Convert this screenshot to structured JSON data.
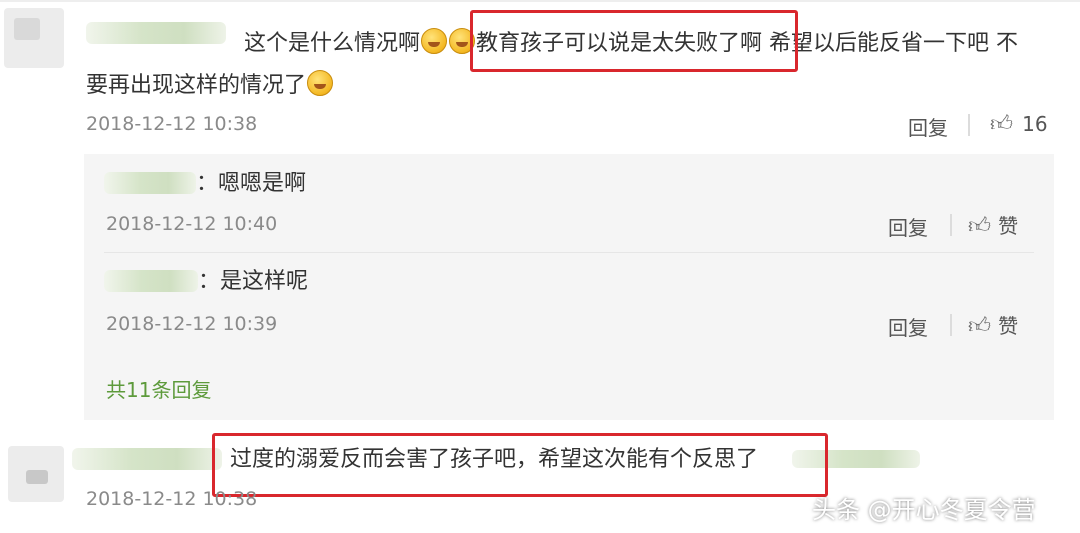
{
  "comment1": {
    "text_part1": "这个是什么情况啊",
    "text_part2": "教育孩子可以说是太失败了啊",
    "text_part3": "希望以后能反省一下吧 不",
    "text_line2": "要再出现这样的情况了",
    "timestamp": "2018-12-12 10:38",
    "reply_label": "回复",
    "like_count": "16"
  },
  "replies": [
    {
      "text": "嗯嗯是啊",
      "timestamp": "2018-12-12 10:40",
      "reply_label": "回复",
      "like_label": "赞"
    },
    {
      "text": "是这样呢",
      "timestamp": "2018-12-12 10:39",
      "reply_label": "回复",
      "like_label": "赞"
    }
  ],
  "more_replies": "共11条回复",
  "comment2": {
    "text": "过度的溺爱反而会害了孩子吧，希望这次能有个反思了",
    "timestamp": "2018-12-12 10:38"
  },
  "watermark": "头条 @开心冬夏令营",
  "icons": {
    "emoji": "laughing-tears-emoji",
    "like": "thumbs-up-icon"
  },
  "colors": {
    "highlight": "#d9272d",
    "more_link": "#5d9a3b",
    "reply_box": "#f5f5f5"
  }
}
